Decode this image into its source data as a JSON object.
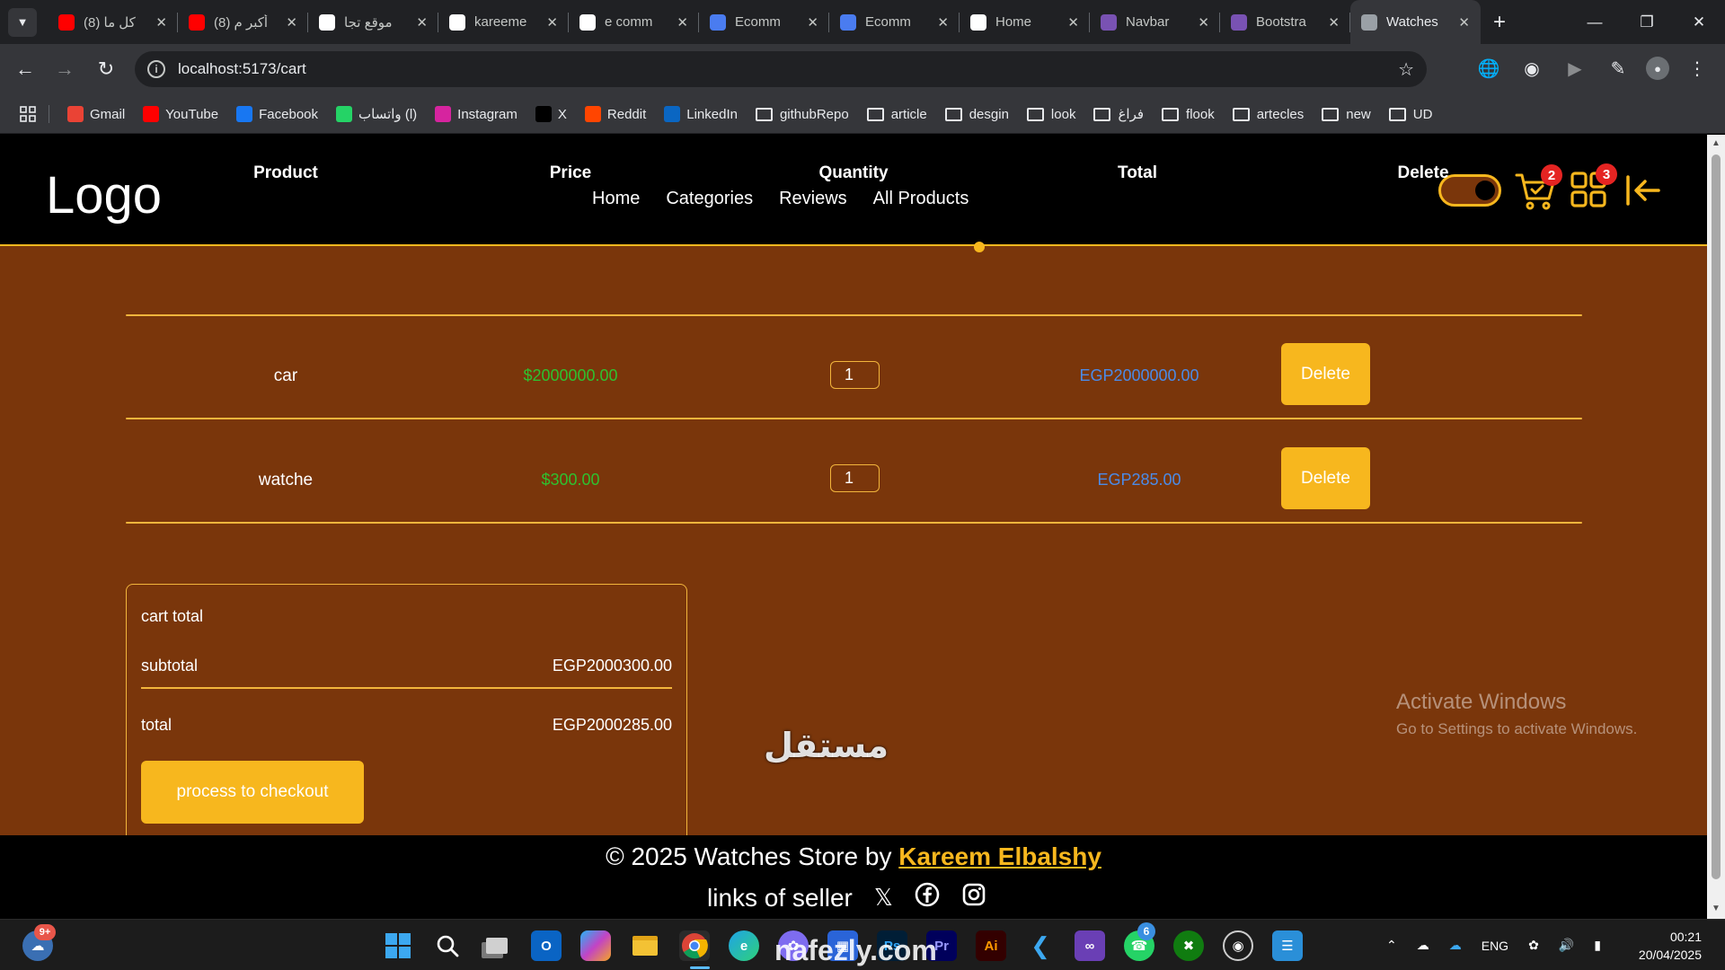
{
  "browser": {
    "tabs": [
      {
        "title": "(8) كل ما",
        "icon": "youtube-icon",
        "color": "#ff0000"
      },
      {
        "title": "(8) أكبر م",
        "icon": "youtube-icon",
        "color": "#ff0000"
      },
      {
        "title": "موقع تجا",
        "icon": "openai-icon",
        "color": "#ffffff"
      },
      {
        "title": "kareeme",
        "icon": "github-icon",
        "color": "#ffffff"
      },
      {
        "title": "e comm",
        "icon": "google-icon",
        "color": "#ffffff"
      },
      {
        "title": "Ecomm",
        "icon": "document-icon",
        "color": "#4a7cf0"
      },
      {
        "title": "Ecomm",
        "icon": "document-icon",
        "color": "#4a7cf0"
      },
      {
        "title": "Home",
        "icon": "s-icon",
        "color": "#ffffff"
      },
      {
        "title": "Navbar",
        "icon": "bootstrap-icon",
        "color": "#7952b3"
      },
      {
        "title": "Bootstra",
        "icon": "bootstrap-icon",
        "color": "#7952b3"
      },
      {
        "title": "Watches",
        "icon": "globe-icon",
        "color": "#9aa0a6"
      }
    ],
    "url": "localhost:5173/cart",
    "bookmarks": [
      {
        "label": "Gmail",
        "type": "gmail"
      },
      {
        "label": "YouTube",
        "type": "youtube"
      },
      {
        "label": "Facebook",
        "type": "facebook"
      },
      {
        "label": "واتساب (l)",
        "type": "whatsapp"
      },
      {
        "label": "Instagram",
        "type": "instagram"
      },
      {
        "label": "X",
        "type": "x"
      },
      {
        "label": "Reddit",
        "type": "reddit"
      },
      {
        "label": "LinkedIn",
        "type": "linkedin"
      },
      {
        "label": "githubRepo",
        "type": "folder"
      },
      {
        "label": "article",
        "type": "folder"
      },
      {
        "label": "desgin",
        "type": "folder"
      },
      {
        "label": "look",
        "type": "folder"
      },
      {
        "label": "فراغ",
        "type": "folder"
      },
      {
        "label": "flook",
        "type": "folder"
      },
      {
        "label": "artecles",
        "type": "folder"
      },
      {
        "label": "new",
        "type": "folder"
      },
      {
        "label": "UD",
        "type": "folder"
      }
    ]
  },
  "site": {
    "logo": "Logo",
    "nav": [
      "Home",
      "Categories",
      "Reviews",
      "All Products"
    ],
    "cart_badge": "2",
    "grid_badge": "3",
    "accent": "#f7b71e",
    "background": "#7a360b"
  },
  "cart": {
    "headers": [
      "Product",
      "Price",
      "Quantity",
      "Total",
      "Delete"
    ],
    "rows": [
      {
        "product": "car",
        "price": "$2000000.00",
        "quantity": "1",
        "total": "EGP2000000.00",
        "delete": "Delete"
      },
      {
        "product": "watche",
        "price": "$300.00",
        "quantity": "1",
        "total": "EGP285.00",
        "delete": "Delete"
      }
    ]
  },
  "totals": {
    "title": "cart total",
    "subtotal_label": "subtotal",
    "subtotal_value": "EGP2000300.00",
    "total_label": "total",
    "total_value": "EGP2000285.00",
    "checkout": "process to checkout"
  },
  "footer": {
    "copy": "© 2025 Watches Store by",
    "author": "Kareem Elbalshy",
    "links_label": "links of seller"
  },
  "overlay": {
    "activate_title": "Activate Windows",
    "activate_sub": "Go to Settings to activate Windows.",
    "watermark_ar": "مستقل",
    "watermark_url": "nafezly.com"
  },
  "taskbar": {
    "weather_badge": "9+",
    "whatsapp_badge": "6",
    "lang": "ENG",
    "time": "00:21",
    "date": "20/04/2025"
  }
}
